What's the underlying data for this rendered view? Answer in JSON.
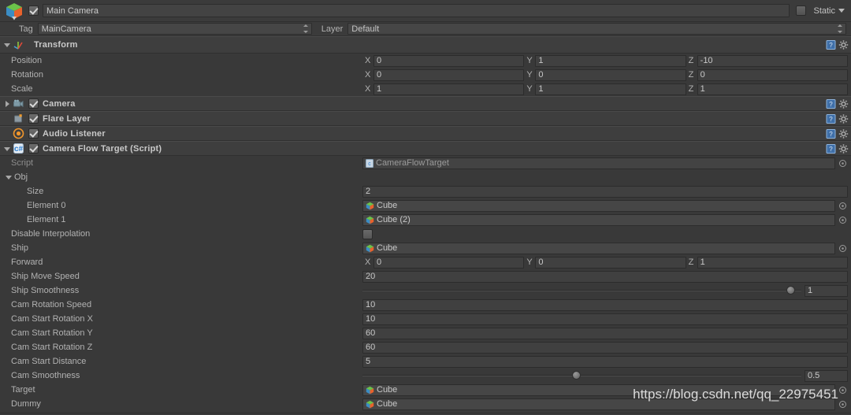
{
  "header": {
    "object_icon": "prefab-cube-icon",
    "enabled": true,
    "name": "Main Camera",
    "static_label": "Static",
    "static_checked": false,
    "tag_label": "Tag",
    "tag_value": "MainCamera",
    "layer_label": "Layer",
    "layer_value": "Default"
  },
  "components": [
    {
      "id": "transform",
      "title": "Transform",
      "icon": "transform-axis-icon",
      "expanded": true,
      "has_enable_toggle": false,
      "rows": [
        {
          "label": "Position",
          "type": "vector3",
          "x": "0",
          "y": "1",
          "z": "-10"
        },
        {
          "label": "Rotation",
          "type": "vector3",
          "x": "0",
          "y": "0",
          "z": "0"
        },
        {
          "label": "Scale",
          "type": "vector3",
          "x": "1",
          "y": "1",
          "z": "1"
        }
      ]
    },
    {
      "id": "camera",
      "title": "Camera",
      "icon": "camera-icon",
      "expanded": false,
      "has_enable_toggle": true,
      "enabled": true,
      "rows": []
    },
    {
      "id": "flare-layer",
      "title": "Flare Layer",
      "icon": "flare-layer-icon",
      "expanded": false,
      "has_foldout": false,
      "has_enable_toggle": true,
      "enabled": true,
      "rows": []
    },
    {
      "id": "audio-listener",
      "title": "Audio Listener",
      "icon": "audio-listener-icon",
      "expanded": false,
      "has_foldout": false,
      "has_enable_toggle": true,
      "enabled": true,
      "rows": []
    },
    {
      "id": "camera-flow-target",
      "title": "Camera Flow Target (Script)",
      "icon": "cs-script-icon",
      "expanded": true,
      "has_enable_toggle": true,
      "enabled": true,
      "rows": []
    }
  ],
  "script_component": {
    "script_row_label": "Script",
    "script_value": "CameraFlowTarget",
    "obj_array": {
      "label": "Obj",
      "expanded": true,
      "size_label": "Size",
      "size_value": "2",
      "elements": [
        {
          "label": "Element 0",
          "value": "Cube"
        },
        {
          "label": "Element 1",
          "value": "Cube (2)"
        }
      ]
    },
    "fields": [
      {
        "label": "Disable Interpolation",
        "type": "bool",
        "value": false
      },
      {
        "label": "Ship",
        "type": "object",
        "value": "Cube"
      },
      {
        "label": "Forward",
        "type": "vector3",
        "x": "0",
        "y": "0",
        "z": "1"
      },
      {
        "label": "Ship Move Speed",
        "type": "number",
        "value": "20"
      },
      {
        "label": "Ship Smoothness",
        "type": "slider",
        "value": "1",
        "fill": 0.985
      },
      {
        "label": "Cam Rotation Speed",
        "type": "number",
        "value": "10"
      },
      {
        "label": "Cam Start Rotation X",
        "type": "number",
        "value": "10"
      },
      {
        "label": "Cam Start Rotation Y",
        "type": "number",
        "value": "60"
      },
      {
        "label": "Cam Start Rotation Z",
        "type": "number",
        "value": "60"
      },
      {
        "label": "Cam Start Distance",
        "type": "number",
        "value": "5"
      },
      {
        "label": "Cam Smoothness",
        "type": "slider",
        "value": "0.5",
        "fill": 0.487
      },
      {
        "label": "Target",
        "type": "object",
        "value": "Cube"
      },
      {
        "label": "Dummy",
        "type": "object",
        "value": "Cube"
      }
    ]
  },
  "watermark": "https://blog.csdn.net/qq_22975451",
  "colors": {
    "panel_bg": "#393939",
    "header_bg": "#3e3e3e",
    "field_bg": "#404040",
    "text": "#b2b2b2",
    "accent_blue": "#4b8ed8",
    "audio_orange": "#f0962c"
  }
}
